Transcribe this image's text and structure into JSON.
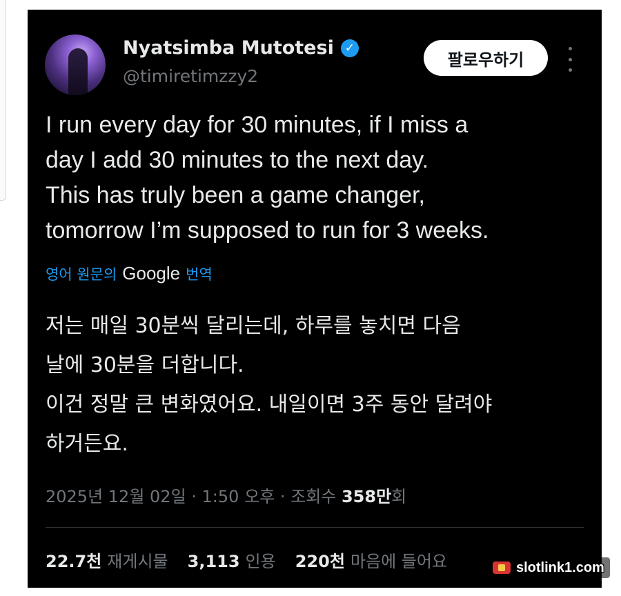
{
  "user": {
    "display_name": "Nyatsimba Mutotesi",
    "handle": "@timiretimzzy2",
    "verified_icon": "check-badge-icon"
  },
  "follow_button": {
    "label": "팔로우하기"
  },
  "tweet": {
    "text": "I run every day for 30 minutes, if I miss a\nday I add 30 minutes to the next day.\nThis has truly been a game changer,\ntomorrow I’m supposed to run for 3 weeks."
  },
  "translation": {
    "prefix": "영어 원문의",
    "provider": "Google",
    "suffix": "번역",
    "text": "저는 매일 30분씩 달리는데, 하루를 놓치면 다음\n날에 30분을 더합니다.\n이건 정말 큰 변화였어요. 내일이면 3주 동안 달려야\n하거든요."
  },
  "meta": {
    "date_time": "2025년 12월 02일 · 1:50 오후 · 조회수 ",
    "views_count": "358만",
    "views_suffix": "회"
  },
  "stats": {
    "reposts_count": "22.7천",
    "reposts_label": "재게시물",
    "quotes_count": "3,113",
    "quotes_label": "인용",
    "likes_count": "220천",
    "likes_label": "마음에 들어요"
  },
  "watermark": {
    "text": "slotlink1.com"
  },
  "colors": {
    "background": "#000000",
    "accent": "#1d9bf0",
    "secondary_text": "#71767b"
  }
}
